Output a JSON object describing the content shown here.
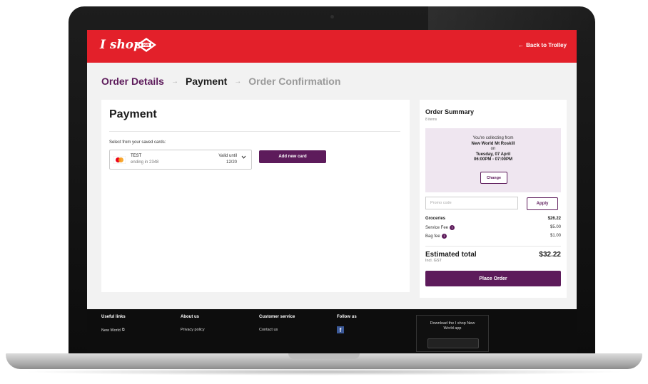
{
  "header": {
    "logo_text": "I shop",
    "badge_text": "NW",
    "back_link": "Back to Trolley",
    "back_arrow": "←"
  },
  "steps": {
    "step1": "Order Details",
    "step2": "Payment",
    "step3": "Order Confirmation",
    "arrow": "→"
  },
  "payment": {
    "title": "Payment",
    "saved_label": "Select from your saved cards:",
    "card": {
      "name": "TEST",
      "ending": "ending in 2348",
      "valid_label": "Valid until",
      "valid_date": "12/20",
      "brand_icon": "mastercard-icon"
    },
    "add_card_button": "Add new card"
  },
  "summary": {
    "title": "Order Summary",
    "items": "8 items",
    "collect_line1": "You're collecting from",
    "store": "New World Mt Roskill",
    "on": "on",
    "date": "Tuesday, 07 April",
    "time": "06:00PM - 07:00PM",
    "change_button": "Change",
    "promo_placeholder": "Promo code",
    "apply_button": "Apply",
    "groceries_label": "Groceries",
    "groceries_value": "$26.22",
    "service_fee_label": "Service Fee",
    "service_fee_value": "$5.00",
    "bag_fee_label": "Bag fee",
    "bag_fee_value": "$1.00",
    "estimated_label": "Estimated total",
    "estimated_value": "$32.22",
    "gst_note": "Incl. GST",
    "place_order_button": "Place Order",
    "info_glyph": "i"
  },
  "footer": {
    "useful_links": "Useful links",
    "new_world_link": "New World",
    "external_glyph": "⧉",
    "about_us": "About us",
    "privacy_link": "Privacy policy",
    "customer_service": "Customer service",
    "contact_link": "Contact us",
    "follow_us": "Follow us",
    "facebook_glyph": "f",
    "app_text_line1": "Download the I shop New",
    "app_text_line2": "World app"
  },
  "colors": {
    "brand_red": "#e3202a",
    "brand_purple": "#5d1b5b",
    "collect_bg": "#efe6f0"
  }
}
